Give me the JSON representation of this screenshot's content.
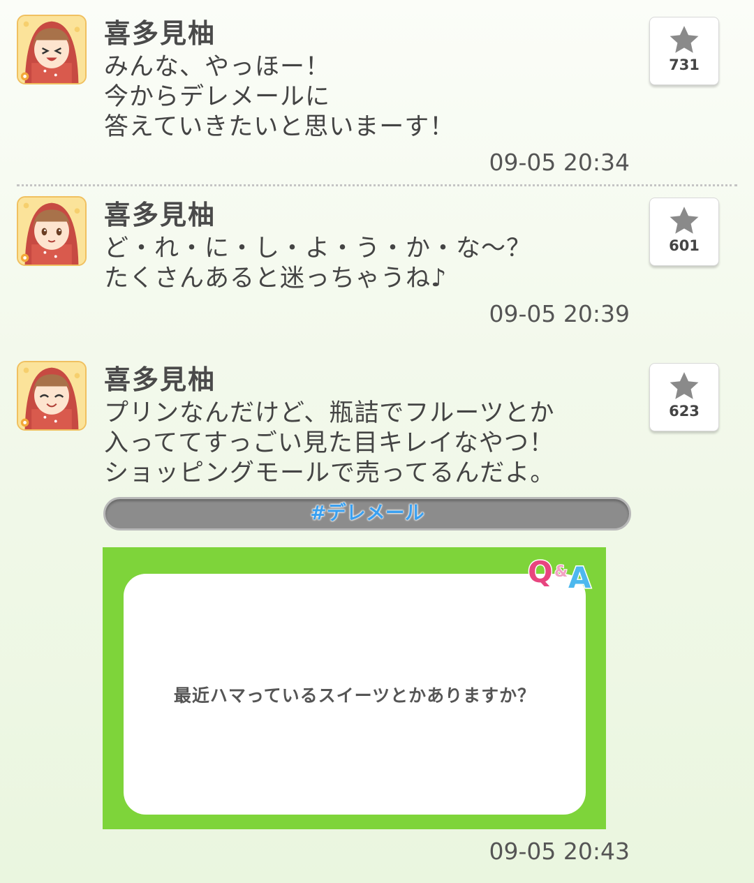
{
  "posts": [
    {
      "name": "喜多見柚",
      "message": "みんな、やっほー！\n今からデレメールに\n答えていきたいと思いまーす！",
      "time": "09-05 20:34",
      "likes": "731",
      "avatar_icon": "girl-avatar-laughing-icon"
    },
    {
      "name": "喜多見柚",
      "message": "ど・れ・に・し・よ・う・か・な～？\nたくさんあると迷っちゃうね♪",
      "time": "09-05 20:39",
      "likes": "601",
      "avatar_icon": "girl-avatar-smiling-icon"
    },
    {
      "name": "喜多見柚",
      "message": "プリンなんだけど、瓶詰でフルーツとか\n入っててすっごい見た目キレイなやつ！\nショッピングモールで売ってるんだよ。",
      "time": "09-05 20:43",
      "likes": "623",
      "avatar_icon": "girl-avatar-happy-icon",
      "hashtag": "#デレメール",
      "card": {
        "badge": "Q&A",
        "question": "最近ハマっているスイーツとかありますか？"
      }
    }
  ],
  "colors": {
    "card_green": "#7ed43a",
    "hashtag_blue": "#3aa0f0",
    "qa_pink": "#e8457f",
    "qa_blue": "#4db8ee"
  }
}
